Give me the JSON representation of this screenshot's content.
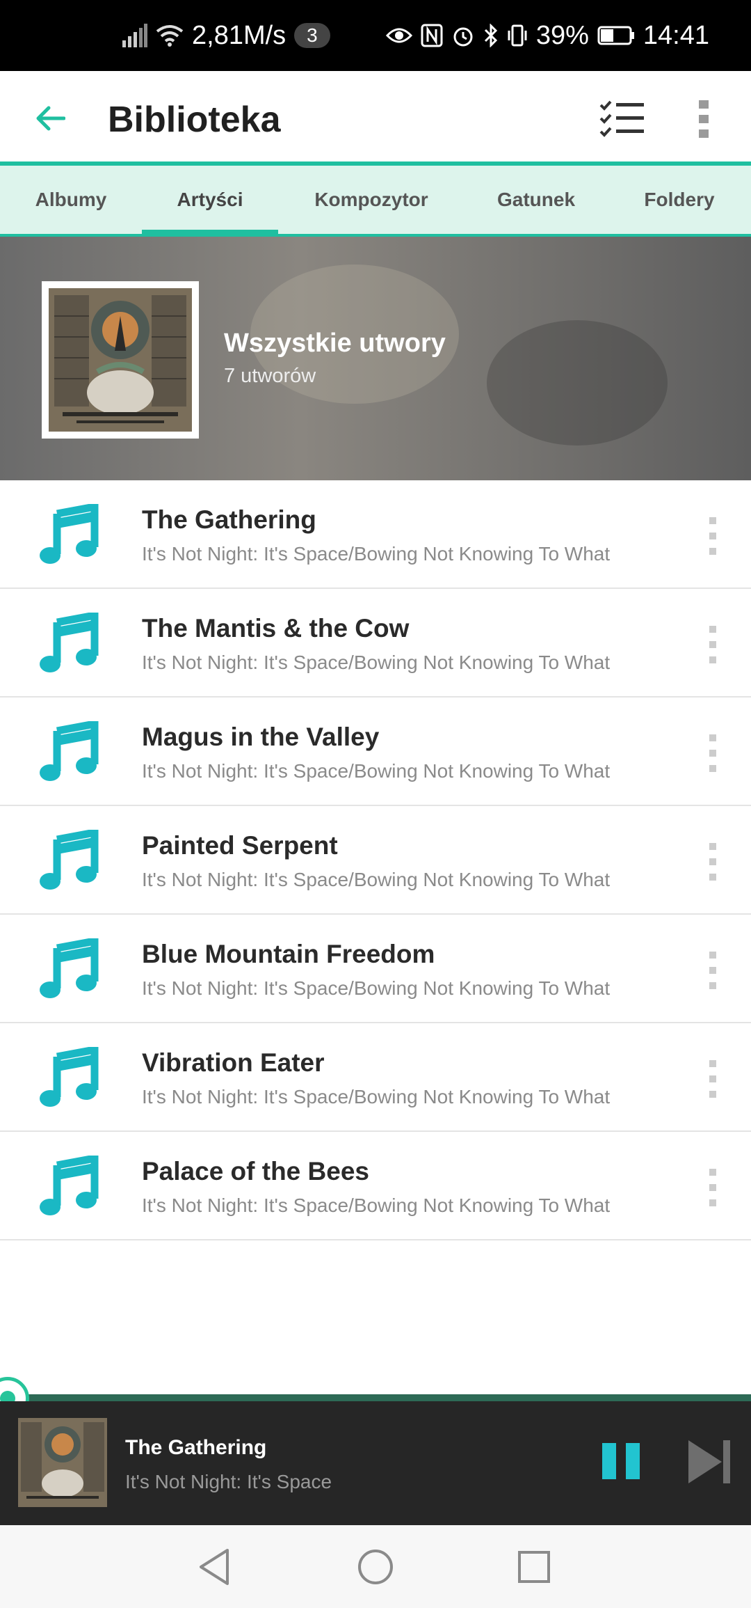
{
  "status_bar": {
    "speed": "2,81M/s",
    "notifications": "3",
    "battery": "39%",
    "time": "14:41"
  },
  "app_bar": {
    "title": "Biblioteka",
    "icons": [
      "back-arrow-icon",
      "checklist-icon",
      "more-vertical-icon"
    ]
  },
  "tabs": [
    {
      "label": "Albumy",
      "active": false
    },
    {
      "label": "Artyści",
      "active": true
    },
    {
      "label": "Kompozytor",
      "active": false
    },
    {
      "label": "Gatunek",
      "active": false
    },
    {
      "label": "Foldery",
      "active": false
    }
  ],
  "header": {
    "title": "Wszystkie utwory",
    "subtitle": "7 utworów"
  },
  "tracks": [
    {
      "title": "The Gathering",
      "subtitle": "It's Not Night: It's Space/Bowing Not Knowing To What"
    },
    {
      "title": "The Mantis & the Cow",
      "subtitle": "It's Not Night: It's Space/Bowing Not Knowing To What"
    },
    {
      "title": "Magus in the Valley",
      "subtitle": "It's Not Night: It's Space/Bowing Not Knowing To What"
    },
    {
      "title": "Painted Serpent",
      "subtitle": "It's Not Night: It's Space/Bowing Not Knowing To What"
    },
    {
      "title": "Blue Mountain Freedom",
      "subtitle": "It's Not Night: It's Space/Bowing Not Knowing To What"
    },
    {
      "title": "Vibration Eater",
      "subtitle": "It's Not Night: It's Space/Bowing Not Knowing To What"
    },
    {
      "title": "Palace of the Bees",
      "subtitle": "It's Not Night: It's Space/Bowing Not Knowing To What"
    }
  ],
  "now_playing": {
    "title": "The Gathering",
    "artist": "It's Not Night: It's Space",
    "progress_fraction": 0.0
  },
  "colors": {
    "accent": "#1fbfa0",
    "tab_background": "#ddf4ec",
    "note_icon": "#1ab8c4",
    "player_background": "#262626",
    "pause_icon": "#22c4d0"
  }
}
